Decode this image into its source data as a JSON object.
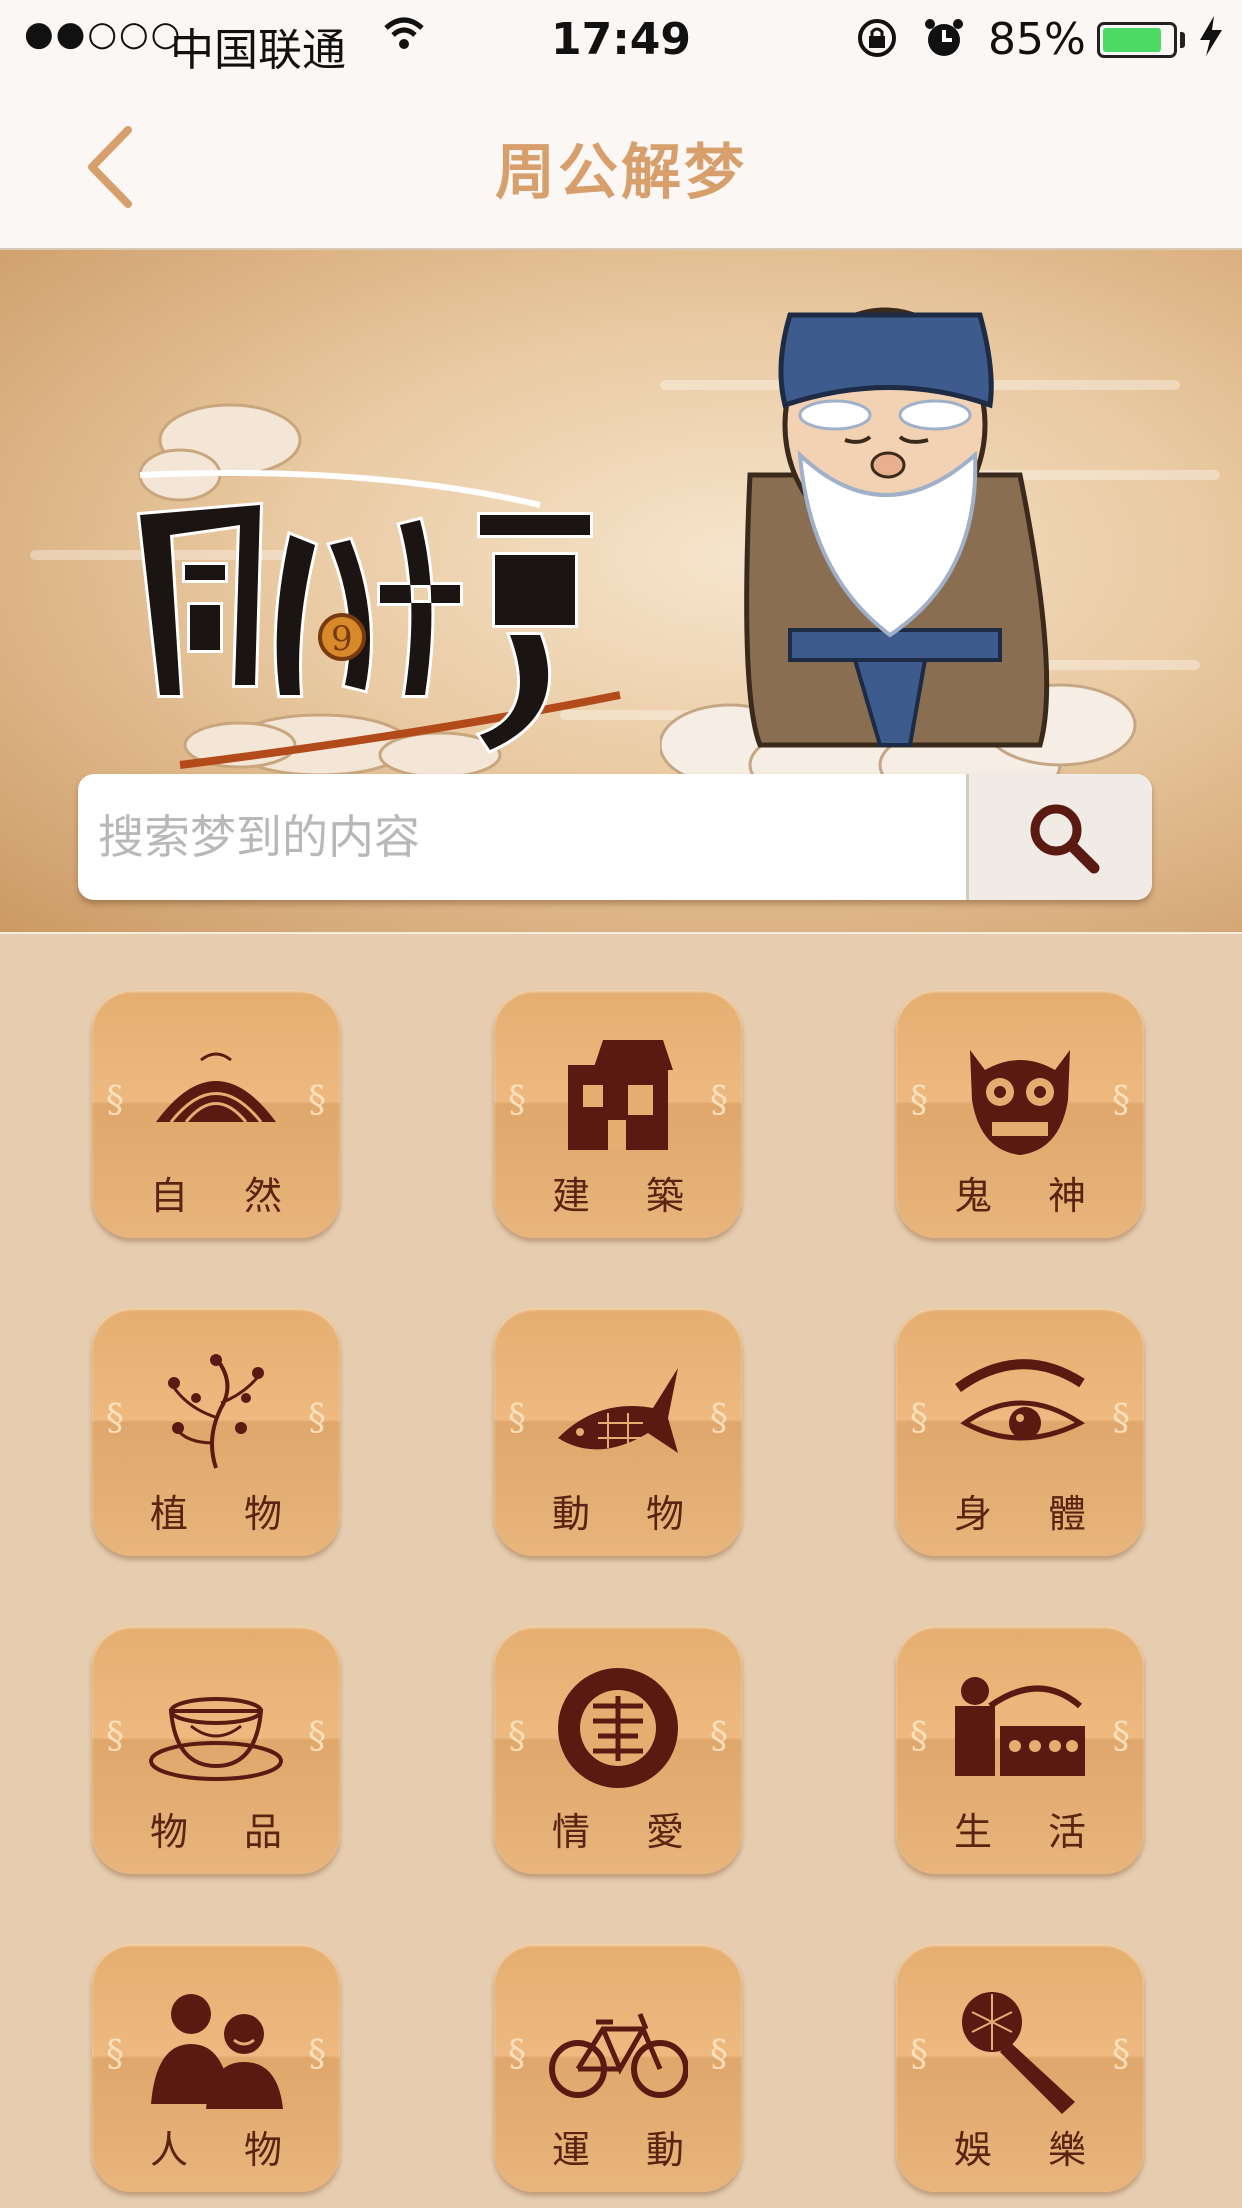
{
  "status_bar": {
    "signal": "●●○○○",
    "carrier": "中国联通",
    "time": "17:49",
    "battery_percent_text": "85%",
    "battery_level": 0.85
  },
  "nav": {
    "title": "周公解梦"
  },
  "search": {
    "placeholder": "搜索梦到的内容"
  },
  "categories": [
    {
      "label": "自 然",
      "icon": "mountain-icon"
    },
    {
      "label": "建 築",
      "icon": "building-icon"
    },
    {
      "label": "鬼 神",
      "icon": "demon-mask-icon"
    },
    {
      "label": "植 物",
      "icon": "plum-branch-icon"
    },
    {
      "label": "動 物",
      "icon": "fish-icon"
    },
    {
      "label": "身 體",
      "icon": "eye-icon"
    },
    {
      "label": "物 品",
      "icon": "bowl-icon"
    },
    {
      "label": "情 愛",
      "icon": "double-happiness-icon"
    },
    {
      "label": "生 活",
      "icon": "market-scene-icon"
    },
    {
      "label": "人 物",
      "icon": "people-icon"
    },
    {
      "label": "運 動",
      "icon": "bicycle-icon"
    },
    {
      "label": "娛 樂",
      "icon": "microphone-icon"
    }
  ],
  "colors": {
    "title": "#d69f6b",
    "tile": "#e5ae70",
    "label": "#5a2412",
    "icon": "#5a1a12",
    "background": "#e6cdb0"
  }
}
